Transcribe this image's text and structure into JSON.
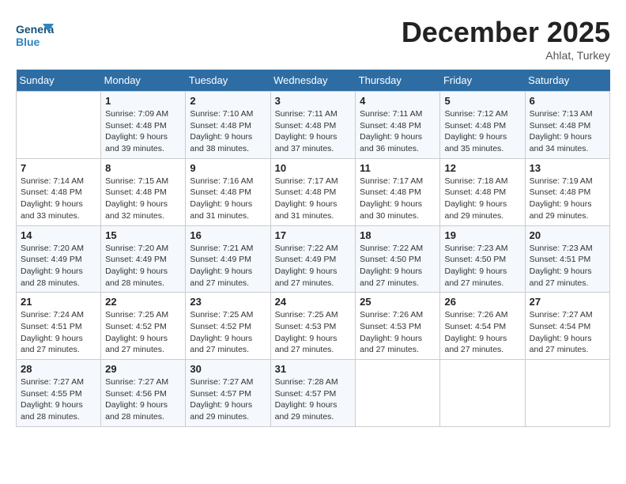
{
  "logo": {
    "line1": "General",
    "line2": "Blue"
  },
  "title": "December 2025",
  "location": "Ahlat, Turkey",
  "days_header": [
    "Sunday",
    "Monday",
    "Tuesday",
    "Wednesday",
    "Thursday",
    "Friday",
    "Saturday"
  ],
  "weeks": [
    [
      {
        "num": "",
        "info": ""
      },
      {
        "num": "1",
        "info": "Sunrise: 7:09 AM\nSunset: 4:48 PM\nDaylight: 9 hours\nand 39 minutes."
      },
      {
        "num": "2",
        "info": "Sunrise: 7:10 AM\nSunset: 4:48 PM\nDaylight: 9 hours\nand 38 minutes."
      },
      {
        "num": "3",
        "info": "Sunrise: 7:11 AM\nSunset: 4:48 PM\nDaylight: 9 hours\nand 37 minutes."
      },
      {
        "num": "4",
        "info": "Sunrise: 7:11 AM\nSunset: 4:48 PM\nDaylight: 9 hours\nand 36 minutes."
      },
      {
        "num": "5",
        "info": "Sunrise: 7:12 AM\nSunset: 4:48 PM\nDaylight: 9 hours\nand 35 minutes."
      },
      {
        "num": "6",
        "info": "Sunrise: 7:13 AM\nSunset: 4:48 PM\nDaylight: 9 hours\nand 34 minutes."
      }
    ],
    [
      {
        "num": "7",
        "info": "Sunrise: 7:14 AM\nSunset: 4:48 PM\nDaylight: 9 hours\nand 33 minutes."
      },
      {
        "num": "8",
        "info": "Sunrise: 7:15 AM\nSunset: 4:48 PM\nDaylight: 9 hours\nand 32 minutes."
      },
      {
        "num": "9",
        "info": "Sunrise: 7:16 AM\nSunset: 4:48 PM\nDaylight: 9 hours\nand 31 minutes."
      },
      {
        "num": "10",
        "info": "Sunrise: 7:17 AM\nSunset: 4:48 PM\nDaylight: 9 hours\nand 31 minutes."
      },
      {
        "num": "11",
        "info": "Sunrise: 7:17 AM\nSunset: 4:48 PM\nDaylight: 9 hours\nand 30 minutes."
      },
      {
        "num": "12",
        "info": "Sunrise: 7:18 AM\nSunset: 4:48 PM\nDaylight: 9 hours\nand 29 minutes."
      },
      {
        "num": "13",
        "info": "Sunrise: 7:19 AM\nSunset: 4:48 PM\nDaylight: 9 hours\nand 29 minutes."
      }
    ],
    [
      {
        "num": "14",
        "info": "Sunrise: 7:20 AM\nSunset: 4:49 PM\nDaylight: 9 hours\nand 28 minutes."
      },
      {
        "num": "15",
        "info": "Sunrise: 7:20 AM\nSunset: 4:49 PM\nDaylight: 9 hours\nand 28 minutes."
      },
      {
        "num": "16",
        "info": "Sunrise: 7:21 AM\nSunset: 4:49 PM\nDaylight: 9 hours\nand 27 minutes."
      },
      {
        "num": "17",
        "info": "Sunrise: 7:22 AM\nSunset: 4:49 PM\nDaylight: 9 hours\nand 27 minutes."
      },
      {
        "num": "18",
        "info": "Sunrise: 7:22 AM\nSunset: 4:50 PM\nDaylight: 9 hours\nand 27 minutes."
      },
      {
        "num": "19",
        "info": "Sunrise: 7:23 AM\nSunset: 4:50 PM\nDaylight: 9 hours\nand 27 minutes."
      },
      {
        "num": "20",
        "info": "Sunrise: 7:23 AM\nSunset: 4:51 PM\nDaylight: 9 hours\nand 27 minutes."
      }
    ],
    [
      {
        "num": "21",
        "info": "Sunrise: 7:24 AM\nSunset: 4:51 PM\nDaylight: 9 hours\nand 27 minutes."
      },
      {
        "num": "22",
        "info": "Sunrise: 7:25 AM\nSunset: 4:52 PM\nDaylight: 9 hours\nand 27 minutes."
      },
      {
        "num": "23",
        "info": "Sunrise: 7:25 AM\nSunset: 4:52 PM\nDaylight: 9 hours\nand 27 minutes."
      },
      {
        "num": "24",
        "info": "Sunrise: 7:25 AM\nSunset: 4:53 PM\nDaylight: 9 hours\nand 27 minutes."
      },
      {
        "num": "25",
        "info": "Sunrise: 7:26 AM\nSunset: 4:53 PM\nDaylight: 9 hours\nand 27 minutes."
      },
      {
        "num": "26",
        "info": "Sunrise: 7:26 AM\nSunset: 4:54 PM\nDaylight: 9 hours\nand 27 minutes."
      },
      {
        "num": "27",
        "info": "Sunrise: 7:27 AM\nSunset: 4:54 PM\nDaylight: 9 hours\nand 27 minutes."
      }
    ],
    [
      {
        "num": "28",
        "info": "Sunrise: 7:27 AM\nSunset: 4:55 PM\nDaylight: 9 hours\nand 28 minutes."
      },
      {
        "num": "29",
        "info": "Sunrise: 7:27 AM\nSunset: 4:56 PM\nDaylight: 9 hours\nand 28 minutes."
      },
      {
        "num": "30",
        "info": "Sunrise: 7:27 AM\nSunset: 4:57 PM\nDaylight: 9 hours\nand 29 minutes."
      },
      {
        "num": "31",
        "info": "Sunrise: 7:28 AM\nSunset: 4:57 PM\nDaylight: 9 hours\nand 29 minutes."
      },
      {
        "num": "",
        "info": ""
      },
      {
        "num": "",
        "info": ""
      },
      {
        "num": "",
        "info": ""
      }
    ]
  ]
}
